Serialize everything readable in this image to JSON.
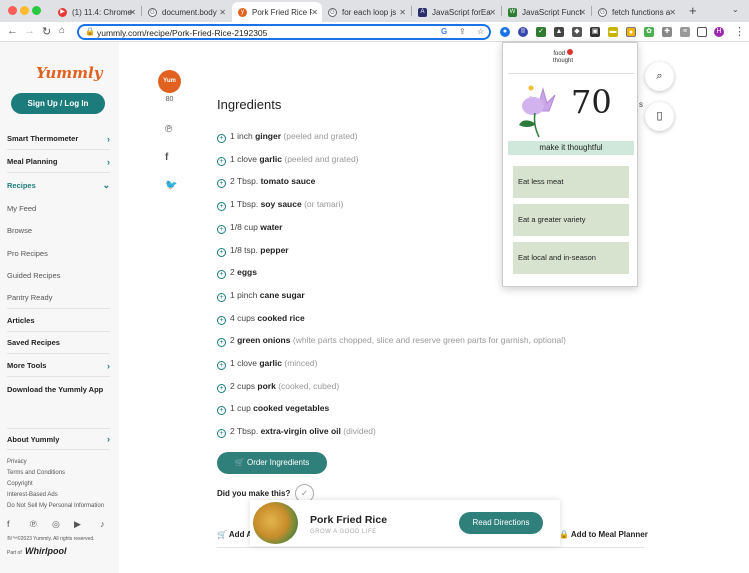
{
  "browser": {
    "tabs": [
      {
        "label": "(1) 11.4: Chrome",
        "icon": "youtube-icon",
        "color": "#e53935"
      },
      {
        "label": "document.body",
        "icon": "google-icon",
        "color": "#5f6368"
      },
      {
        "label": "Pork Fried Rice R",
        "icon": "yummly-icon",
        "color": "#e16120",
        "active": true
      },
      {
        "label": "for each loop js",
        "icon": "google-icon",
        "color": "#5f6368"
      },
      {
        "label": "JavaScript forEa",
        "icon": "js-icon",
        "color": "#2b2f6e"
      },
      {
        "label": "JavaScript Functi",
        "icon": "w-icon",
        "color": "#2e7d32"
      },
      {
        "label": "fetch functions a",
        "icon": "google-icon",
        "color": "#5f6368"
      }
    ],
    "url": "yummly.com/recipe/Pork-Fried-Rice-2192305",
    "new_tab": "+",
    "profile_initial": "H"
  },
  "sidebar": {
    "logo": "Yummly",
    "signup": "Sign Up / Log In",
    "nav": [
      {
        "label": "Smart Thermometer",
        "style": "bold",
        "chevron": "›"
      },
      {
        "label": "Meal Planning",
        "style": "bold",
        "chevron": "›"
      },
      {
        "label": "Recipes",
        "style": "teal",
        "chevron": "⌄"
      },
      {
        "label": "My Feed",
        "style": "plain"
      },
      {
        "label": "Browse",
        "style": "plain"
      },
      {
        "label": "Pro Recipes",
        "style": "plain"
      },
      {
        "label": "Guided Recipes",
        "style": "plain"
      },
      {
        "label": "Pantry Ready",
        "style": "plain"
      },
      {
        "label": "Articles",
        "style": "bold"
      },
      {
        "label": "Saved Recipes",
        "style": "bold"
      },
      {
        "label": "More Tools",
        "style": "bold",
        "chevron": "›"
      },
      {
        "label": "Download the Yummly App",
        "style": "bold"
      }
    ],
    "about": "About Yummly",
    "legal": [
      "Privacy",
      "Terms and Conditions",
      "Copyright",
      "Interest-Based Ads",
      "Do Not Sell My Personal Information"
    ],
    "copyright": "®/™©2023 Yummly. All rights reserved.",
    "part_of": "Part of",
    "whirlpool": "Whirlpool"
  },
  "rail": {
    "badge": "Yum",
    "count": "80"
  },
  "recipe": {
    "heading": "Ingredients",
    "ingredients": [
      {
        "qty": "1 inch",
        "name": "ginger",
        "note": "(peeled and grated)"
      },
      {
        "qty": "1 clove",
        "name": "garlic",
        "note": "(peeled and grated)"
      },
      {
        "qty": "2 Tbsp.",
        "name": "tomato sauce",
        "note": ""
      },
      {
        "qty": "1 Tbsp.",
        "name": "soy sauce",
        "note": "(or tamari)"
      },
      {
        "qty": "1/8 cup",
        "name": "water",
        "note": ""
      },
      {
        "qty": "1/8 tsp.",
        "name": "pepper",
        "note": ""
      },
      {
        "qty": "2",
        "name": "eggs",
        "note": ""
      },
      {
        "qty": "1 pinch",
        "name": "cane sugar",
        "note": ""
      },
      {
        "qty": "4 cups",
        "name": "cooked rice",
        "note": ""
      },
      {
        "qty": "2",
        "name": "green onions",
        "note": "(white parts chopped, slice and reserve green parts for garnish, optional)"
      },
      {
        "qty": "1 clove",
        "name": "garlic",
        "note": "(minced)"
      },
      {
        "qty": "2 cups",
        "name": "pork",
        "note": "(cooked, cubed)"
      },
      {
        "qty": "1 cup",
        "name": "cooked vegetables",
        "note": ""
      },
      {
        "qty": "2 Tbsp.",
        "name": "extra-virgin olive oil",
        "note": "(divided)"
      }
    ],
    "order_button": "Order Ingredients",
    "did_you_make": "Did you make this?",
    "add_left": "Add A",
    "add_meal_planner": "Add to Meal Planner",
    "peek_text": "s"
  },
  "sticky": {
    "title": "Pork Fried Rice",
    "subtitle": "GROW A GOOD LIFE",
    "button": "Read Directions"
  },
  "popup": {
    "logo_line1": "food",
    "logo_line2": "thought",
    "score": "70",
    "tagline": "make it thoughtful",
    "goals": [
      "Eat less meat",
      "Eat a greater variety",
      "Eat local and in-season"
    ]
  },
  "colors": {
    "brand_teal": "#1c7b7b",
    "yummly_orange": "#e16120",
    "popup_green": "#d7e3cf",
    "tagline_green": "#cfe8db"
  }
}
